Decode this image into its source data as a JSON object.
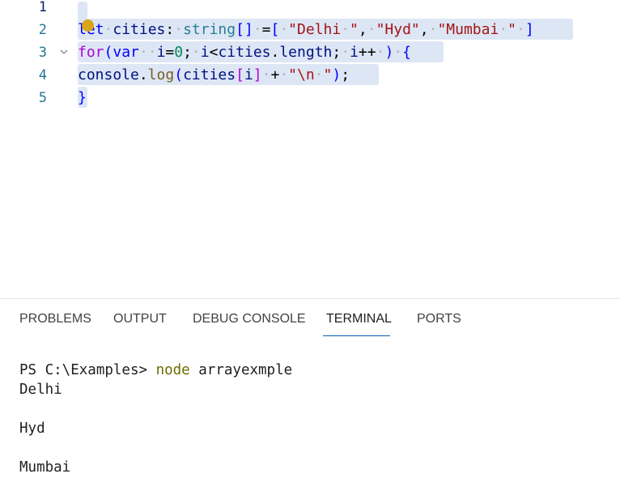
{
  "editor": {
    "lines": [
      {
        "num": "1",
        "segments": []
      },
      {
        "num": "2",
        "segments": [
          {
            "t": "let",
            "c": "kw"
          },
          {
            "t": "·",
            "c": "dot"
          },
          {
            "t": "cities",
            "c": "var"
          },
          {
            "t": ":",
            "c": "pl"
          },
          {
            "t": "·",
            "c": "dot"
          },
          {
            "t": "string",
            "c": "type"
          },
          {
            "t": "[]",
            "c": "kw"
          },
          {
            "t": "·",
            "c": "dot"
          },
          {
            "t": "=",
            "c": "pl"
          },
          {
            "t": "[",
            "c": "kw"
          },
          {
            "t": "·",
            "c": "dot"
          },
          {
            "t": "\"Delhi",
            "c": "str"
          },
          {
            "t": "·",
            "c": "dot"
          },
          {
            "t": "\"",
            "c": "str"
          },
          {
            "t": ",",
            "c": "pl"
          },
          {
            "t": "·",
            "c": "dot"
          },
          {
            "t": "\"Hyd\"",
            "c": "str"
          },
          {
            "t": ",",
            "c": "pl"
          },
          {
            "t": "·",
            "c": "dot"
          },
          {
            "t": "\"Mumbai",
            "c": "str"
          },
          {
            "t": "·",
            "c": "dot"
          },
          {
            "t": "\"",
            "c": "str"
          },
          {
            "t": "·",
            "c": "dot"
          },
          {
            "t": "]",
            "c": "kw"
          }
        ]
      },
      {
        "num": "3",
        "segments": [
          {
            "t": "for",
            "c": "ctrl"
          },
          {
            "t": "(",
            "c": "kw"
          },
          {
            "t": "var",
            "c": "kw"
          },
          {
            "t": "··",
            "c": "dot"
          },
          {
            "t": "i",
            "c": "var"
          },
          {
            "t": "=",
            "c": "pl"
          },
          {
            "t": "0",
            "c": "num"
          },
          {
            "t": ";",
            "c": "pl"
          },
          {
            "t": "·",
            "c": "dot"
          },
          {
            "t": "i",
            "c": "var"
          },
          {
            "t": "<",
            "c": "pl"
          },
          {
            "t": "cities",
            "c": "var"
          },
          {
            "t": ".",
            "c": "pl"
          },
          {
            "t": "length",
            "c": "var"
          },
          {
            "t": ";",
            "c": "pl"
          },
          {
            "t": "·",
            "c": "dot"
          },
          {
            "t": "i",
            "c": "var"
          },
          {
            "t": "++",
            "c": "pl"
          },
          {
            "t": "·",
            "c": "dot"
          },
          {
            "t": ")",
            "c": "kw"
          },
          {
            "t": "·",
            "c": "dot"
          },
          {
            "t": "{",
            "c": "kw"
          }
        ]
      },
      {
        "num": "4",
        "segments": [
          {
            "t": "console",
            "c": "var"
          },
          {
            "t": ".",
            "c": "pl"
          },
          {
            "t": "log",
            "c": "fn"
          },
          {
            "t": "(",
            "c": "kw"
          },
          {
            "t": "cities",
            "c": "var"
          },
          {
            "t": "[",
            "c": "ctrl"
          },
          {
            "t": "i",
            "c": "var"
          },
          {
            "t": "]",
            "c": "ctrl"
          },
          {
            "t": "·",
            "c": "dot"
          },
          {
            "t": "+",
            "c": "pl"
          },
          {
            "t": "·",
            "c": "dot"
          },
          {
            "t": "\"\\n",
            "c": "str"
          },
          {
            "t": "·",
            "c": "dot"
          },
          {
            "t": "\"",
            "c": "str"
          },
          {
            "t": ")",
            "c": "kw"
          },
          {
            "t": ";",
            "c": "pl"
          }
        ]
      },
      {
        "num": "5",
        "segments": [
          {
            "t": "}",
            "c": "kw"
          }
        ]
      }
    ]
  },
  "panel": {
    "tabs": [
      "PROBLEMS",
      "OUTPUT",
      "DEBUG CONSOLE",
      "TERMINAL",
      "PORTS"
    ],
    "active_tab": "TERMINAL"
  },
  "terminal": {
    "prompt": "PS C:\\Examples> ",
    "command": "node",
    "args": " arrayexmple",
    "output": [
      "Delhi",
      "",
      "Hyd",
      "",
      "Mumbai"
    ]
  },
  "colors": {
    "accent": "#005fb8",
    "selection": "#dde6f4",
    "lightbulb": "#d8a619"
  }
}
